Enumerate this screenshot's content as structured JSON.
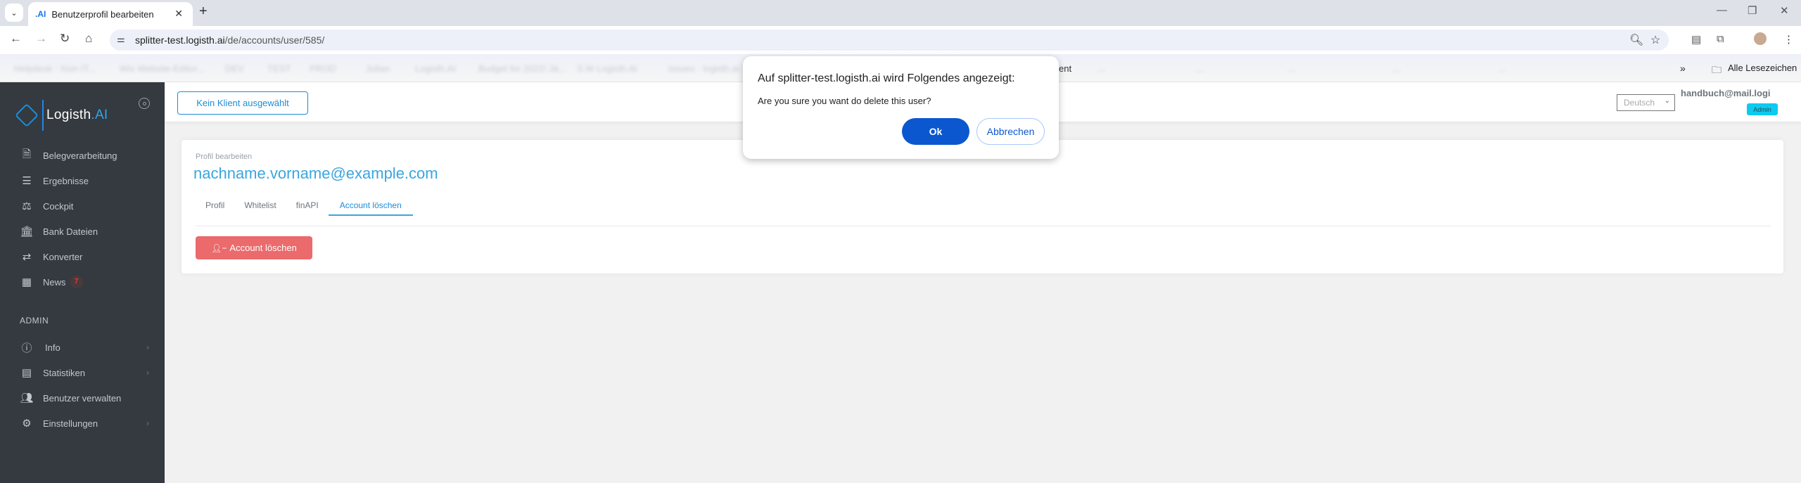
{
  "browser": {
    "tab_title": "Benutzerprofil bearbeiten",
    "tab_favicon": ".AI",
    "url_host": "splitter-test.logisth.ai",
    "url_path": "/de/accounts/user/585/",
    "bookmarks": [
      "Helpdesk : Xion IT...",
      "Wix Website-Editor...",
      "DEV",
      "TEST",
      "PROD",
      "Julian",
      "Logisth.AI",
      "Budget for 2022/ Jä...",
      "S.W Logisth.AI",
      "Issues · logisth.ai",
      "ent",
      "...",
      "...",
      "...",
      "...",
      "..."
    ],
    "all_bookmarks_label": "Alle Lesezeichen",
    "icons": {
      "tab_list": "chevron-down-icon",
      "new_tab": "plus-icon",
      "back": "arrow-left-icon",
      "forward": "arrow-right-icon",
      "reload": "reload-icon",
      "home": "home-icon",
      "site_settings": "tune-icon",
      "zoom": "zoom-out-icon",
      "bookmark": "star-icon",
      "extensions": "puzzle-icon",
      "menu": "kebab-menu-icon"
    }
  },
  "sidebar": {
    "logo_text": "Logisth",
    "logo_suffix": ".AI",
    "items": [
      {
        "label": "Belegverarbeitung",
        "icon": "document-icon"
      },
      {
        "label": "Ergebnisse",
        "icon": "list-icon"
      },
      {
        "label": "Cockpit",
        "icon": "balance-scale-icon"
      },
      {
        "label": "Bank Dateien",
        "icon": "bank-icon"
      },
      {
        "label": "Konverter",
        "icon": "exchange-icon"
      },
      {
        "label": "News",
        "icon": "newspaper-icon",
        "badge": "7"
      }
    ],
    "admin_heading": "ADMIN",
    "admin_items": [
      {
        "label": "Info",
        "icon": "info-icon",
        "has_submenu": true
      },
      {
        "label": "Statistiken",
        "icon": "book-icon",
        "has_submenu": true
      },
      {
        "label": "Benutzer verwalten",
        "icon": "users-icon",
        "has_submenu": false
      },
      {
        "label": "Einstellungen",
        "icon": "cogs-icon",
        "has_submenu": true
      }
    ]
  },
  "topbar": {
    "client_button": "Kein Klient ausgewählt",
    "language": "Deutsch",
    "user_email": "handbuch@mail.logi",
    "user_role": "Admin"
  },
  "profile": {
    "subtitle": "Profil bearbeiten",
    "email": "nachname.vorname@example.com",
    "tabs": [
      {
        "label": "Profil",
        "active": false
      },
      {
        "label": "Whitelist",
        "active": false
      },
      {
        "label": "finAPI",
        "active": false
      },
      {
        "label": "Account löschen",
        "active": true
      }
    ],
    "delete_button": "Account löschen"
  },
  "dialog": {
    "title": "Auf splitter-test.logisth.ai wird Folgendes angezeigt:",
    "message": "Are you sure you want do delete this user?",
    "ok_label": "Ok",
    "cancel_label": "Abbrechen"
  },
  "colors": {
    "accent": "#1c8dd8",
    "sidebar_bg": "#343a40",
    "danger": "#eb6a6c",
    "dialog_primary": "#0b57d0",
    "admin_badge": "#0dcaf0"
  }
}
